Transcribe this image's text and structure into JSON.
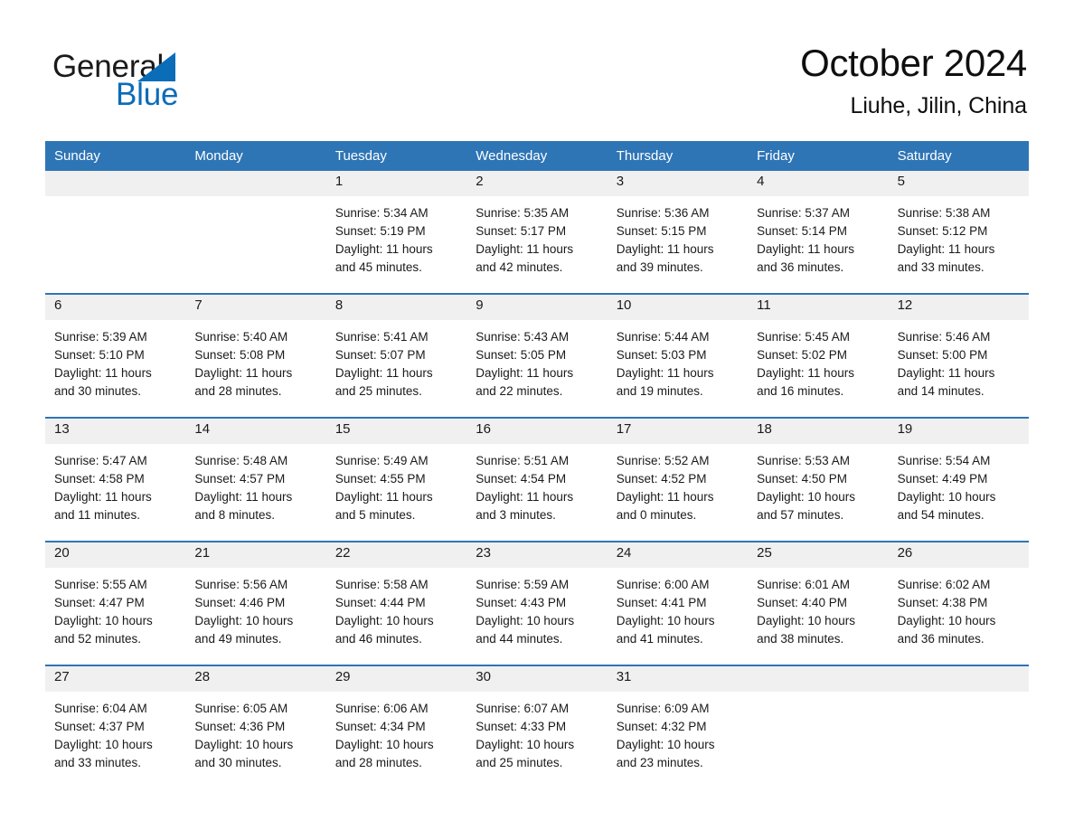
{
  "brand": {
    "name_part1": "General",
    "name_part2": "Blue",
    "triangle_icon": "triangle-logo-icon",
    "accent_color": "#0b6cb8"
  },
  "header": {
    "month_title": "October 2024",
    "location": "Liuhe, Jilin, China"
  },
  "calendar": {
    "header_color": "#2e75b6",
    "date_band_color": "#f0f0f0",
    "weekdays": [
      "Sunday",
      "Monday",
      "Tuesday",
      "Wednesday",
      "Thursday",
      "Friday",
      "Saturday"
    ],
    "weeks": [
      [
        {
          "day": "",
          "sunrise": "",
          "sunset": "",
          "daylight_line1": "",
          "daylight_line2": ""
        },
        {
          "day": "",
          "sunrise": "",
          "sunset": "",
          "daylight_line1": "",
          "daylight_line2": ""
        },
        {
          "day": "1",
          "sunrise": "Sunrise: 5:34 AM",
          "sunset": "Sunset: 5:19 PM",
          "daylight_line1": "Daylight: 11 hours",
          "daylight_line2": "and 45 minutes."
        },
        {
          "day": "2",
          "sunrise": "Sunrise: 5:35 AM",
          "sunset": "Sunset: 5:17 PM",
          "daylight_line1": "Daylight: 11 hours",
          "daylight_line2": "and 42 minutes."
        },
        {
          "day": "3",
          "sunrise": "Sunrise: 5:36 AM",
          "sunset": "Sunset: 5:15 PM",
          "daylight_line1": "Daylight: 11 hours",
          "daylight_line2": "and 39 minutes."
        },
        {
          "day": "4",
          "sunrise": "Sunrise: 5:37 AM",
          "sunset": "Sunset: 5:14 PM",
          "daylight_line1": "Daylight: 11 hours",
          "daylight_line2": "and 36 minutes."
        },
        {
          "day": "5",
          "sunrise": "Sunrise: 5:38 AM",
          "sunset": "Sunset: 5:12 PM",
          "daylight_line1": "Daylight: 11 hours",
          "daylight_line2": "and 33 minutes."
        }
      ],
      [
        {
          "day": "6",
          "sunrise": "Sunrise: 5:39 AM",
          "sunset": "Sunset: 5:10 PM",
          "daylight_line1": "Daylight: 11 hours",
          "daylight_line2": "and 30 minutes."
        },
        {
          "day": "7",
          "sunrise": "Sunrise: 5:40 AM",
          "sunset": "Sunset: 5:08 PM",
          "daylight_line1": "Daylight: 11 hours",
          "daylight_line2": "and 28 minutes."
        },
        {
          "day": "8",
          "sunrise": "Sunrise: 5:41 AM",
          "sunset": "Sunset: 5:07 PM",
          "daylight_line1": "Daylight: 11 hours",
          "daylight_line2": "and 25 minutes."
        },
        {
          "day": "9",
          "sunrise": "Sunrise: 5:43 AM",
          "sunset": "Sunset: 5:05 PM",
          "daylight_line1": "Daylight: 11 hours",
          "daylight_line2": "and 22 minutes."
        },
        {
          "day": "10",
          "sunrise": "Sunrise: 5:44 AM",
          "sunset": "Sunset: 5:03 PM",
          "daylight_line1": "Daylight: 11 hours",
          "daylight_line2": "and 19 minutes."
        },
        {
          "day": "11",
          "sunrise": "Sunrise: 5:45 AM",
          "sunset": "Sunset: 5:02 PM",
          "daylight_line1": "Daylight: 11 hours",
          "daylight_line2": "and 16 minutes."
        },
        {
          "day": "12",
          "sunrise": "Sunrise: 5:46 AM",
          "sunset": "Sunset: 5:00 PM",
          "daylight_line1": "Daylight: 11 hours",
          "daylight_line2": "and 14 minutes."
        }
      ],
      [
        {
          "day": "13",
          "sunrise": "Sunrise: 5:47 AM",
          "sunset": "Sunset: 4:58 PM",
          "daylight_line1": "Daylight: 11 hours",
          "daylight_line2": "and 11 minutes."
        },
        {
          "day": "14",
          "sunrise": "Sunrise: 5:48 AM",
          "sunset": "Sunset: 4:57 PM",
          "daylight_line1": "Daylight: 11 hours",
          "daylight_line2": "and 8 minutes."
        },
        {
          "day": "15",
          "sunrise": "Sunrise: 5:49 AM",
          "sunset": "Sunset: 4:55 PM",
          "daylight_line1": "Daylight: 11 hours",
          "daylight_line2": "and 5 minutes."
        },
        {
          "day": "16",
          "sunrise": "Sunrise: 5:51 AM",
          "sunset": "Sunset: 4:54 PM",
          "daylight_line1": "Daylight: 11 hours",
          "daylight_line2": "and 3 minutes."
        },
        {
          "day": "17",
          "sunrise": "Sunrise: 5:52 AM",
          "sunset": "Sunset: 4:52 PM",
          "daylight_line1": "Daylight: 11 hours",
          "daylight_line2": "and 0 minutes."
        },
        {
          "day": "18",
          "sunrise": "Sunrise: 5:53 AM",
          "sunset": "Sunset: 4:50 PM",
          "daylight_line1": "Daylight: 10 hours",
          "daylight_line2": "and 57 minutes."
        },
        {
          "day": "19",
          "sunrise": "Sunrise: 5:54 AM",
          "sunset": "Sunset: 4:49 PM",
          "daylight_line1": "Daylight: 10 hours",
          "daylight_line2": "and 54 minutes."
        }
      ],
      [
        {
          "day": "20",
          "sunrise": "Sunrise: 5:55 AM",
          "sunset": "Sunset: 4:47 PM",
          "daylight_line1": "Daylight: 10 hours",
          "daylight_line2": "and 52 minutes."
        },
        {
          "day": "21",
          "sunrise": "Sunrise: 5:56 AM",
          "sunset": "Sunset: 4:46 PM",
          "daylight_line1": "Daylight: 10 hours",
          "daylight_line2": "and 49 minutes."
        },
        {
          "day": "22",
          "sunrise": "Sunrise: 5:58 AM",
          "sunset": "Sunset: 4:44 PM",
          "daylight_line1": "Daylight: 10 hours",
          "daylight_line2": "and 46 minutes."
        },
        {
          "day": "23",
          "sunrise": "Sunrise: 5:59 AM",
          "sunset": "Sunset: 4:43 PM",
          "daylight_line1": "Daylight: 10 hours",
          "daylight_line2": "and 44 minutes."
        },
        {
          "day": "24",
          "sunrise": "Sunrise: 6:00 AM",
          "sunset": "Sunset: 4:41 PM",
          "daylight_line1": "Daylight: 10 hours",
          "daylight_line2": "and 41 minutes."
        },
        {
          "day": "25",
          "sunrise": "Sunrise: 6:01 AM",
          "sunset": "Sunset: 4:40 PM",
          "daylight_line1": "Daylight: 10 hours",
          "daylight_line2": "and 38 minutes."
        },
        {
          "day": "26",
          "sunrise": "Sunrise: 6:02 AM",
          "sunset": "Sunset: 4:38 PM",
          "daylight_line1": "Daylight: 10 hours",
          "daylight_line2": "and 36 minutes."
        }
      ],
      [
        {
          "day": "27",
          "sunrise": "Sunrise: 6:04 AM",
          "sunset": "Sunset: 4:37 PM",
          "daylight_line1": "Daylight: 10 hours",
          "daylight_line2": "and 33 minutes."
        },
        {
          "day": "28",
          "sunrise": "Sunrise: 6:05 AM",
          "sunset": "Sunset: 4:36 PM",
          "daylight_line1": "Daylight: 10 hours",
          "daylight_line2": "and 30 minutes."
        },
        {
          "day": "29",
          "sunrise": "Sunrise: 6:06 AM",
          "sunset": "Sunset: 4:34 PM",
          "daylight_line1": "Daylight: 10 hours",
          "daylight_line2": "and 28 minutes."
        },
        {
          "day": "30",
          "sunrise": "Sunrise: 6:07 AM",
          "sunset": "Sunset: 4:33 PM",
          "daylight_line1": "Daylight: 10 hours",
          "daylight_line2": "and 25 minutes."
        },
        {
          "day": "31",
          "sunrise": "Sunrise: 6:09 AM",
          "sunset": "Sunset: 4:32 PM",
          "daylight_line1": "Daylight: 10 hours",
          "daylight_line2": "and 23 minutes."
        },
        {
          "day": "",
          "sunrise": "",
          "sunset": "",
          "daylight_line1": "",
          "daylight_line2": ""
        },
        {
          "day": "",
          "sunrise": "",
          "sunset": "",
          "daylight_line1": "",
          "daylight_line2": ""
        }
      ]
    ]
  }
}
